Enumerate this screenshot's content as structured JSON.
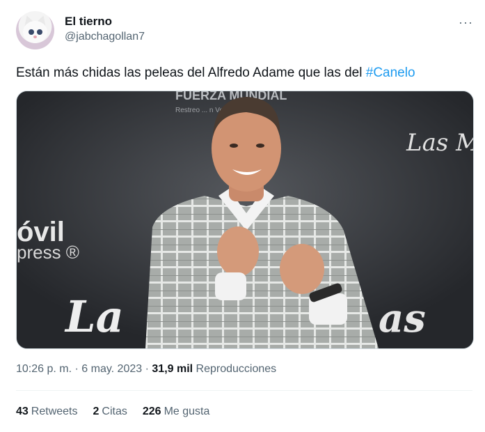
{
  "author": {
    "display_name": "El tierno",
    "handle": "@jabchagollan7"
  },
  "more_icon": "···",
  "tweet": {
    "text": "Están más chidas las peleas del Alfredo Adame que las del ",
    "hashtag": "#Canelo"
  },
  "photo": {
    "backdrop_top": "FUERZA MUNDIAL",
    "backdrop_top_sub": "Restreo ... n Vehicular",
    "backdrop_left_1": "óvil",
    "backdrop_left_2": "press ®",
    "backdrop_right": "Las M",
    "backdrop_bottom_left": "La",
    "backdrop_bottom_right": "as"
  },
  "meta": {
    "time": "10:26 p. m.",
    "sep1": "·",
    "date": "6 may. 2023",
    "sep2": "·",
    "views_count": "31,9 mil",
    "views_label": "Reproducciones"
  },
  "stats": {
    "retweets_count": "43",
    "retweets_label": "Retweets",
    "quotes_count": "2",
    "quotes_label": "Citas",
    "likes_count": "226",
    "likes_label": "Me gusta"
  },
  "colors": {
    "accent": "#1d9bf0",
    "text": "#0f1419",
    "muted": "#536471"
  }
}
